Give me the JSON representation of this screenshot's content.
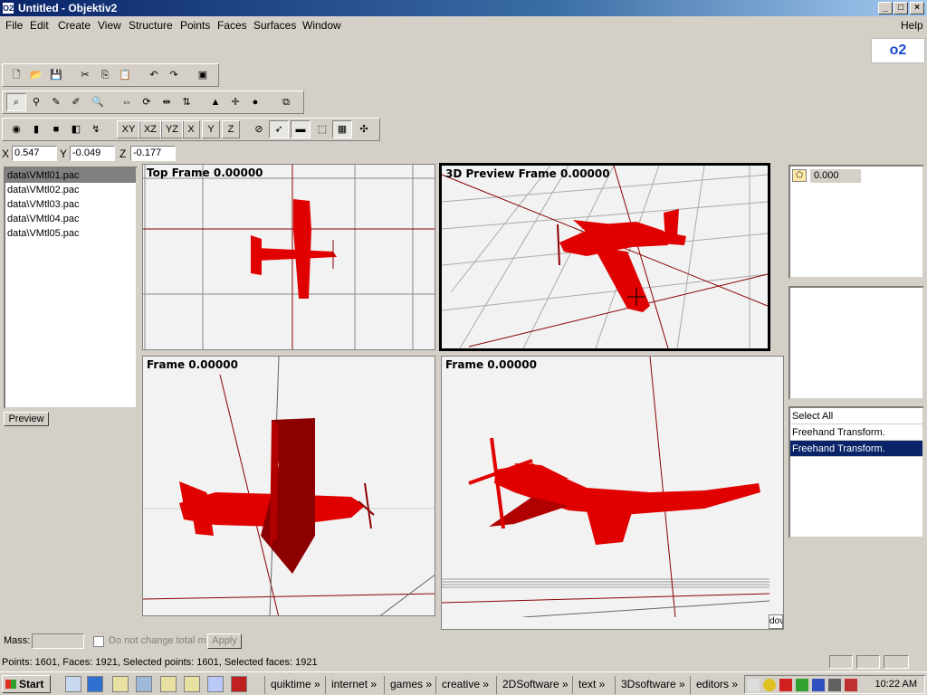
{
  "window": {
    "title": "Untitled - Objektiv2",
    "icon_label": "O2"
  },
  "menu": [
    "File",
    "Edit",
    "Create",
    "View",
    "Structure",
    "Points",
    "Faces",
    "Surfaces",
    "Window"
  ],
  "help": "Help",
  "logo_text": "o2",
  "axis_buttons": [
    "XY",
    "XZ",
    "YZ",
    "X",
    "Y",
    "Z"
  ],
  "coords": {
    "x_label": "X",
    "x": "0.547",
    "y_label": "Y",
    "y": "-0.049",
    "z_label": "Z",
    "z": "-0.177"
  },
  "files": [
    "data\\VMtl01.pac",
    "data\\VMtl02.pac",
    "data\\VMtl03.pac",
    "data\\VMtl04.pac",
    "data\\VMtl05.pac"
  ],
  "preview_button": "Preview",
  "viewports": {
    "top": "Top Frame 0.00000",
    "preview3d": "3D Preview Frame 0.00000",
    "bottom_left": "Frame 0.00000",
    "bottom_right": "Frame 0.00000",
    "corner_tag": "dov"
  },
  "right_panel": {
    "value": "0.000",
    "list": [
      "Select All",
      "Freehand Transform.",
      "Freehand Transform."
    ]
  },
  "mass": {
    "label": "Mass:",
    "checkbox_label": "Do not change total mass",
    "apply": "Apply"
  },
  "status": "Points: 1601, Faces: 1921, Selected points: 1601, Selected faces: 1921",
  "taskbar": {
    "start": "Start",
    "items": [
      "quiktime",
      "internet",
      "games",
      "creative",
      "2DSoftware",
      "text",
      "3Dsoftware",
      "editors"
    ],
    "clock": "10:22 AM"
  },
  "colors": {
    "model": "#e00000",
    "selection": "#0a246a",
    "titlebar": "#0a246a"
  }
}
